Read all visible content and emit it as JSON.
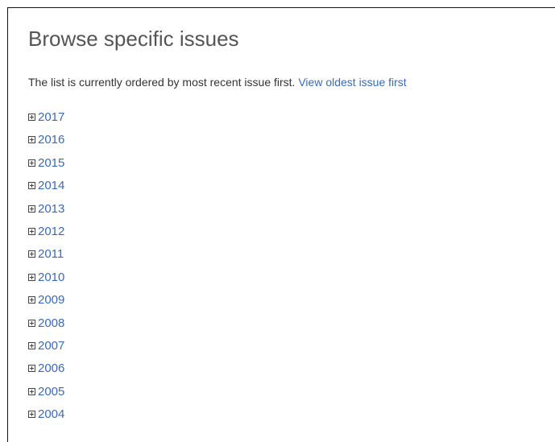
{
  "heading": "Browse specific issues",
  "order": {
    "text": "The list is currently ordered by most recent issue first.",
    "link_label": "View oldest issue first"
  },
  "icons": {
    "expand": "plus-square-icon"
  },
  "colors": {
    "link": "#3a6ab8",
    "heading": "#555555",
    "body_text": "#333333"
  },
  "years": [
    "2017",
    "2016",
    "2015",
    "2014",
    "2013",
    "2012",
    "2011",
    "2010",
    "2009",
    "2008",
    "2007",
    "2006",
    "2005",
    "2004"
  ]
}
